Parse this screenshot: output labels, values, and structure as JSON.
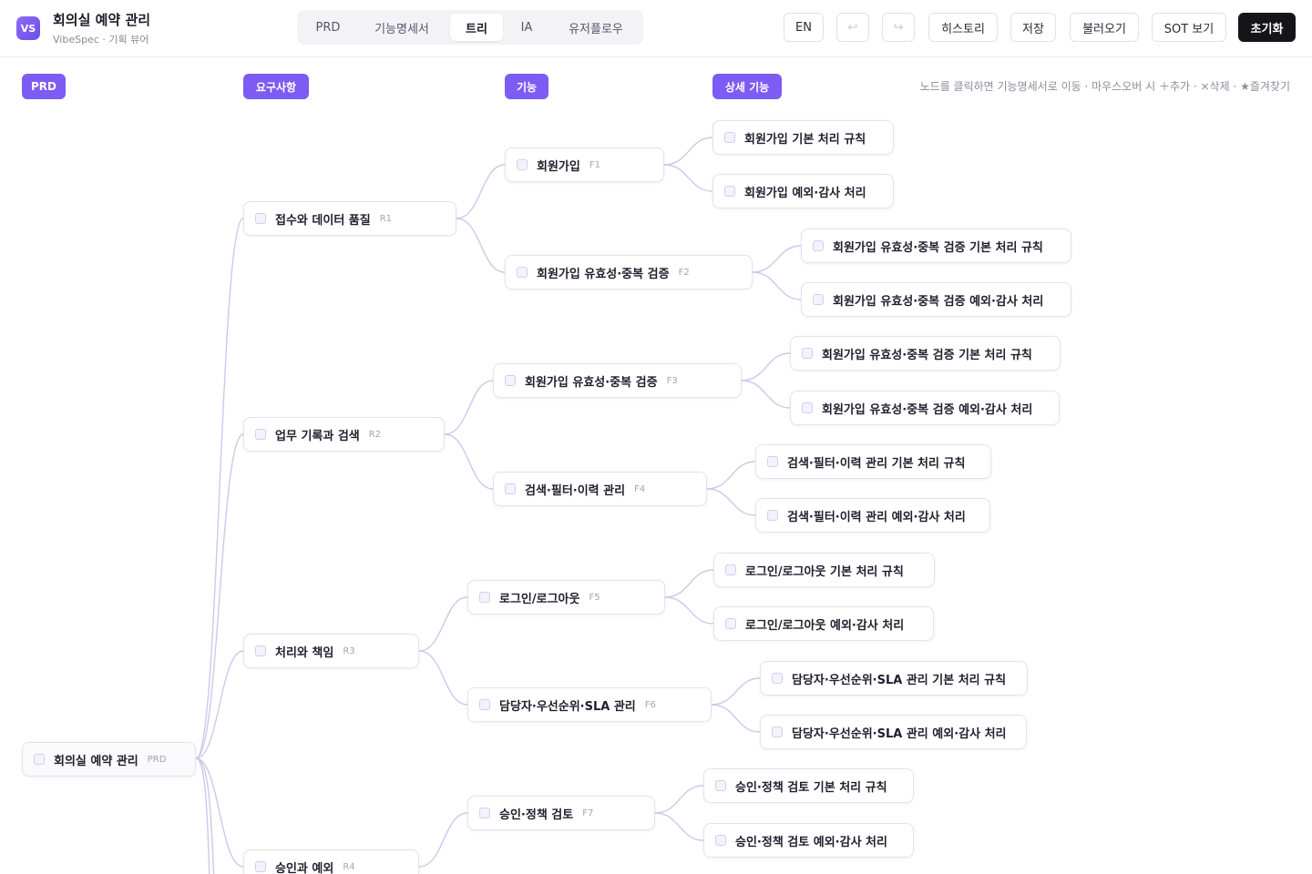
{
  "app": {
    "logo": "VS",
    "title": "회의실 예약 관리",
    "subtitle": "VibeSpec · 기획 뷰어"
  },
  "tabs": [
    {
      "label": "PRD",
      "active": false
    },
    {
      "label": "기능명세서",
      "active": false
    },
    {
      "label": "트리",
      "active": true
    },
    {
      "label": "IA",
      "active": false
    },
    {
      "label": "유저플로우",
      "active": false
    }
  ],
  "toolbar": {
    "lang": "EN",
    "undo_icon": "↩",
    "redo_icon": "↪",
    "history": "히스토리",
    "save": "저장",
    "load": "불러오기",
    "sot": "SOT 보기",
    "reset": "초기화"
  },
  "levels": [
    "PRD",
    "요구사항",
    "기능",
    "상세 기능"
  ],
  "hint": "노드를 클릭하면 기능명세서로 이동 · 마우스오버 시 ＋추가 · ×삭제 · ★즐겨찾기",
  "accent": "#7c5cf2",
  "tree": {
    "root": {
      "label": "회의실 예약 관리",
      "code": "PRD"
    },
    "requirements": [
      {
        "label": "접수와 데이터 품질",
        "code": "R1"
      },
      {
        "label": "업무 기록과 검색",
        "code": "R2"
      },
      {
        "label": "처리와 책임",
        "code": "R3"
      },
      {
        "label": "승인과 예외",
        "code": "R4"
      }
    ],
    "features": [
      {
        "label": "회원가입",
        "code": "F1"
      },
      {
        "label": "회원가입 유효성·중복 검증",
        "code": "F2"
      },
      {
        "label": "회원가입 유효성·중복 검증",
        "code": "F3"
      },
      {
        "label": "검색·필터·이력 관리",
        "code": "F4"
      },
      {
        "label": "로그인/로그아웃",
        "code": "F5"
      },
      {
        "label": "담당자·우선순위·SLA 관리",
        "code": "F6"
      },
      {
        "label": "승인·정책 검토",
        "code": "F7"
      }
    ],
    "details": [
      {
        "label": "회원가입 기본 처리 규칙"
      },
      {
        "label": "회원가입 예외·감사 처리"
      },
      {
        "label": "회원가입 유효성·중복 검증 기본 처리 규칙"
      },
      {
        "label": "회원가입 유효성·중복 검증 예외·감사 처리"
      },
      {
        "label": "회원가입 유효성·중복 검증 기본 처리 규칙"
      },
      {
        "label": "회원가입 유효성·중복 검증 예외·감사 처리"
      },
      {
        "label": "검색·필터·이력 관리 기본 처리 규칙"
      },
      {
        "label": "검색·필터·이력 관리 예외·감사 처리"
      },
      {
        "label": "로그인/로그아웃 기본 처리 규칙"
      },
      {
        "label": "로그인/로그아웃 예외·감사 처리"
      },
      {
        "label": "담당자·우선순위·SLA 관리 기본 처리 규칙"
      },
      {
        "label": "담당자·우선순위·SLA 관리 예외·감사 처리"
      },
      {
        "label": "승인·정책 검토 기본 처리 규칙"
      },
      {
        "label": "승인·정책 검토 예외·감사 처리"
      }
    ]
  }
}
